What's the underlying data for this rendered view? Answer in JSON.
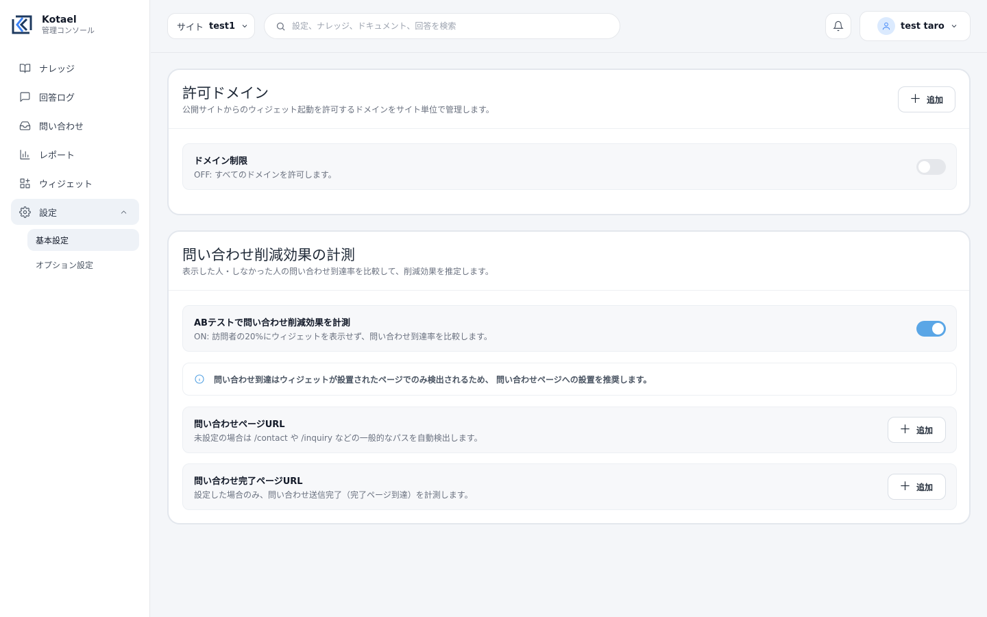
{
  "brand": {
    "name": "Kotael",
    "subtitle": "管理コンソール"
  },
  "sidebar": {
    "items": [
      {
        "label": "ナレッジ",
        "icon": "book-open-icon"
      },
      {
        "label": "回答ログ",
        "icon": "message-square-icon"
      },
      {
        "label": "問い合わせ",
        "icon": "inbox-icon"
      },
      {
        "label": "レポート",
        "icon": "bar-chart-icon"
      },
      {
        "label": "ウィジェット",
        "icon": "grid-plus-icon"
      },
      {
        "label": "設定",
        "icon": "gear-icon",
        "expanded": true
      }
    ],
    "subitems": [
      {
        "label": "基本設定",
        "active": true
      },
      {
        "label": "オプション設定"
      }
    ]
  },
  "header": {
    "site_key": "サイト",
    "site_value": "test1",
    "search_placeholder": "設定、ナレッジ、ドキュメント、回答を検索",
    "user_name": "test taro"
  },
  "domain_card": {
    "title": "許可ドメイン",
    "description": "公開サイトからのウィジェット起動を許可するドメインをサイト単位で管理します。",
    "add_label": "追加",
    "restriction_title": "ドメイン制限",
    "restriction_desc": "OFF: すべてのドメインを許可します。",
    "restriction_on": false
  },
  "ab_card": {
    "title": "問い合わせ削減効果の計測",
    "description": "表示した人・しなかった人の問い合わせ到達率を比較して、削減効果を推定します。",
    "ab_title": "ABテストで問い合わせ削減効果を計測",
    "ab_desc": "ON: 訪問者の20%にウィジェットを表示せず、問い合わせ到達率を比較します。",
    "ab_on": true,
    "info": "問い合わせ到達はウィジェットが設置されたページでのみ検出されるため、 問い合わせページへの設置を推奨します。",
    "contact_title": "問い合わせページURL",
    "contact_desc": "未設定の場合は /contact や /inquiry などの一般的なパスを自動検出します。",
    "complete_title": "問い合わせ完了ページURL",
    "complete_desc": "設定した場合のみ、問い合わせ送信完了（完了ページ到達）を計測します。",
    "add_label": "追加"
  },
  "colors": {
    "accent": "#5aa6e6",
    "brand": "#1e3a5f"
  }
}
